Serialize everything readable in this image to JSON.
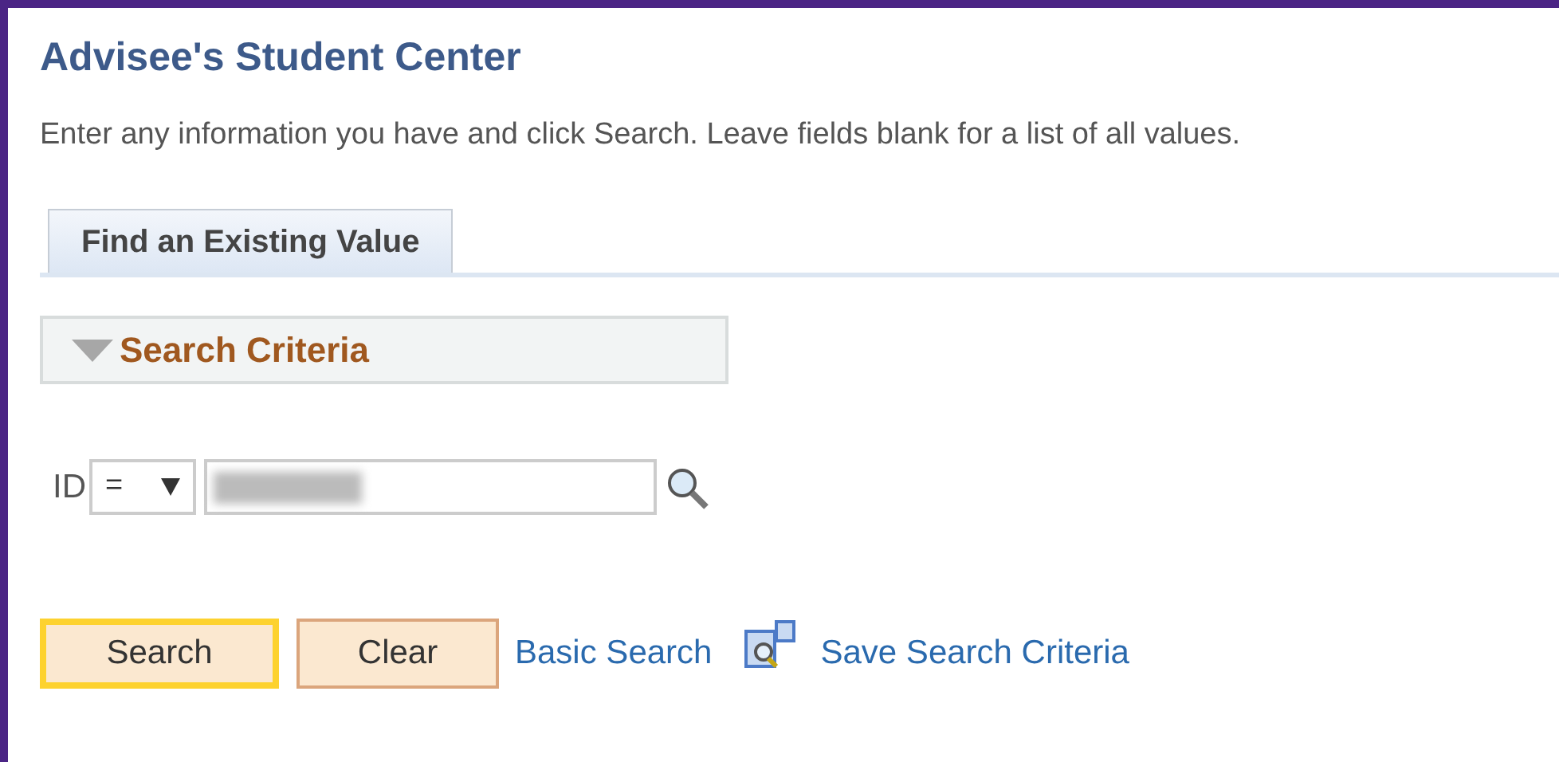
{
  "page_title": "Advisee's Student Center",
  "instructions": "Enter any information you have and click Search. Leave fields blank for a list of all values.",
  "tabs": [
    {
      "label": "Find an Existing Value",
      "selected": true
    }
  ],
  "section": {
    "title": "Search Criteria",
    "expanded": true
  },
  "fields": [
    {
      "label": "ID",
      "operator": "="
    }
  ],
  "buttons": [
    {
      "label": "Search",
      "kind": "primary"
    },
    {
      "label": "Clear",
      "kind": "secondary"
    }
  ],
  "links": [
    {
      "label": "Basic Search",
      "kind": "plain"
    },
    {
      "label": "Save Search Criteria",
      "kind": "save"
    }
  ]
}
